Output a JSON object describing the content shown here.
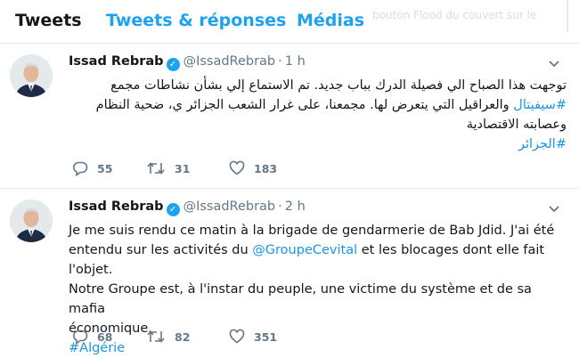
{
  "tabs": [
    {
      "label": "Tweets"
    },
    {
      "label": "Tweets & réponses"
    },
    {
      "label": "Médias"
    }
  ],
  "faded_bg_text": "bouton Flood du couvert sur le",
  "tweets": [
    {
      "author": "Issad Rebrab",
      "handle": "@IssadRebrab",
      "time": "1 h",
      "lines": [
        {
          "text": "توجهت هذا الصباح الي فصيلة الدرك بباب جديد. تم الاستماع إلي بشأن نشاطات مجمع"
        },
        {
          "tag": "#سيفيتال",
          "text": " والعراقيل التي يتعرض لها. مجمعنا، على غرار الشعب الجزائر ي، ضحية النظام"
        },
        {
          "text": "وعصابته الاقتصادية"
        },
        {
          "tag": "#الجزائر"
        }
      ],
      "replies": "55",
      "retweets": "31",
      "likes": "183"
    },
    {
      "author": "Issad Rebrab",
      "handle": "@IssadRebrab",
      "time": "2 h",
      "line1": "Je me suis rendu ce matin à la brigade de gendarmerie de Bab Jdid. J'ai été",
      "line2_pre": "entendu sur les activités du ",
      "line2_mention": "@GroupeCevital",
      "line2_post": " et les blocages dont elle fait l'objet.",
      "line3": "Notre Groupe est, à l'instar du peuple, une victime du système et de sa mafia",
      "line4": "économique.",
      "line5_tag": "#Algérie",
      "replies": "68",
      "retweets": "82",
      "likes": "351"
    }
  ],
  "colors": {
    "accent": "#1da1f2",
    "link": "#1b95e0",
    "muted": "#657786",
    "divider": "#e6ecf0"
  },
  "icons": [
    "verified-badge-icon",
    "caret-down-icon",
    "reply-icon",
    "retweet-icon",
    "like-icon"
  ]
}
